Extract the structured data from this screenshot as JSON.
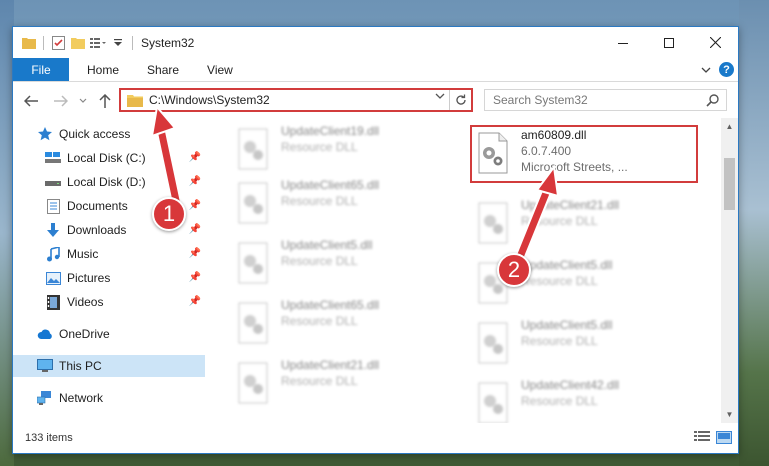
{
  "window": {
    "title": "System32"
  },
  "ribbon": {
    "tabs": [
      "File",
      "Home",
      "Share",
      "View"
    ]
  },
  "address": {
    "path": "C:\\Windows\\System32"
  },
  "search": {
    "placeholder": "Search System32"
  },
  "sidebar": {
    "items": [
      {
        "label": "Quick access",
        "icon": "star-icon",
        "pinned": false
      },
      {
        "label": "Local Disk (C:)",
        "icon": "drive-icon",
        "pinned": true
      },
      {
        "label": "Local Disk (D:)",
        "icon": "drive-icon",
        "pinned": true
      },
      {
        "label": "Documents",
        "icon": "documents-icon",
        "pinned": true
      },
      {
        "label": "Downloads",
        "icon": "downloads-icon",
        "pinned": true
      },
      {
        "label": "Music",
        "icon": "music-icon",
        "pinned": true
      },
      {
        "label": "Pictures",
        "icon": "pictures-icon",
        "pinned": true
      },
      {
        "label": "Videos",
        "icon": "videos-icon",
        "pinned": true
      },
      {
        "label": "OneDrive",
        "icon": "onedrive-icon",
        "pinned": false
      },
      {
        "label": "This PC",
        "icon": "this-pc-icon",
        "pinned": false,
        "selected": true
      },
      {
        "label": "Network",
        "icon": "network-icon",
        "pinned": false
      }
    ]
  },
  "files": {
    "left_column": [
      {
        "name": "UpdateClient19.dll",
        "type": "Resource DLL"
      },
      {
        "name": "UpdateClient65.dll",
        "type": "Resource DLL"
      },
      {
        "name": "UpdateClient5.dll",
        "type": "Resource DLL"
      },
      {
        "name": "UpdateClient65.dll",
        "type": "Resource DLL"
      },
      {
        "name": "UpdateClient21.dll",
        "type": "Resource DLL"
      }
    ],
    "right_column": [
      {
        "name": "UpdateClient21.dll",
        "type": "Resource DLL"
      },
      {
        "name": "UpdateClient5.dll",
        "type": "Resource DLL"
      },
      {
        "name": "UpdateClient5.dll",
        "type": "Resource DLL"
      },
      {
        "name": "UpdateClient42.dll",
        "type": "Resource DLL"
      }
    ],
    "highlighted": {
      "name": "am60809.dll",
      "version": "6.0.7.400",
      "company": "Microsoft Streets, ..."
    }
  },
  "status": {
    "item_count": "133 items"
  },
  "callouts": {
    "one": "1",
    "two": "2"
  },
  "colors": {
    "accent": "#1979ca",
    "highlight_red": "#d23c3c",
    "selected_bg": "#cce4f7"
  }
}
